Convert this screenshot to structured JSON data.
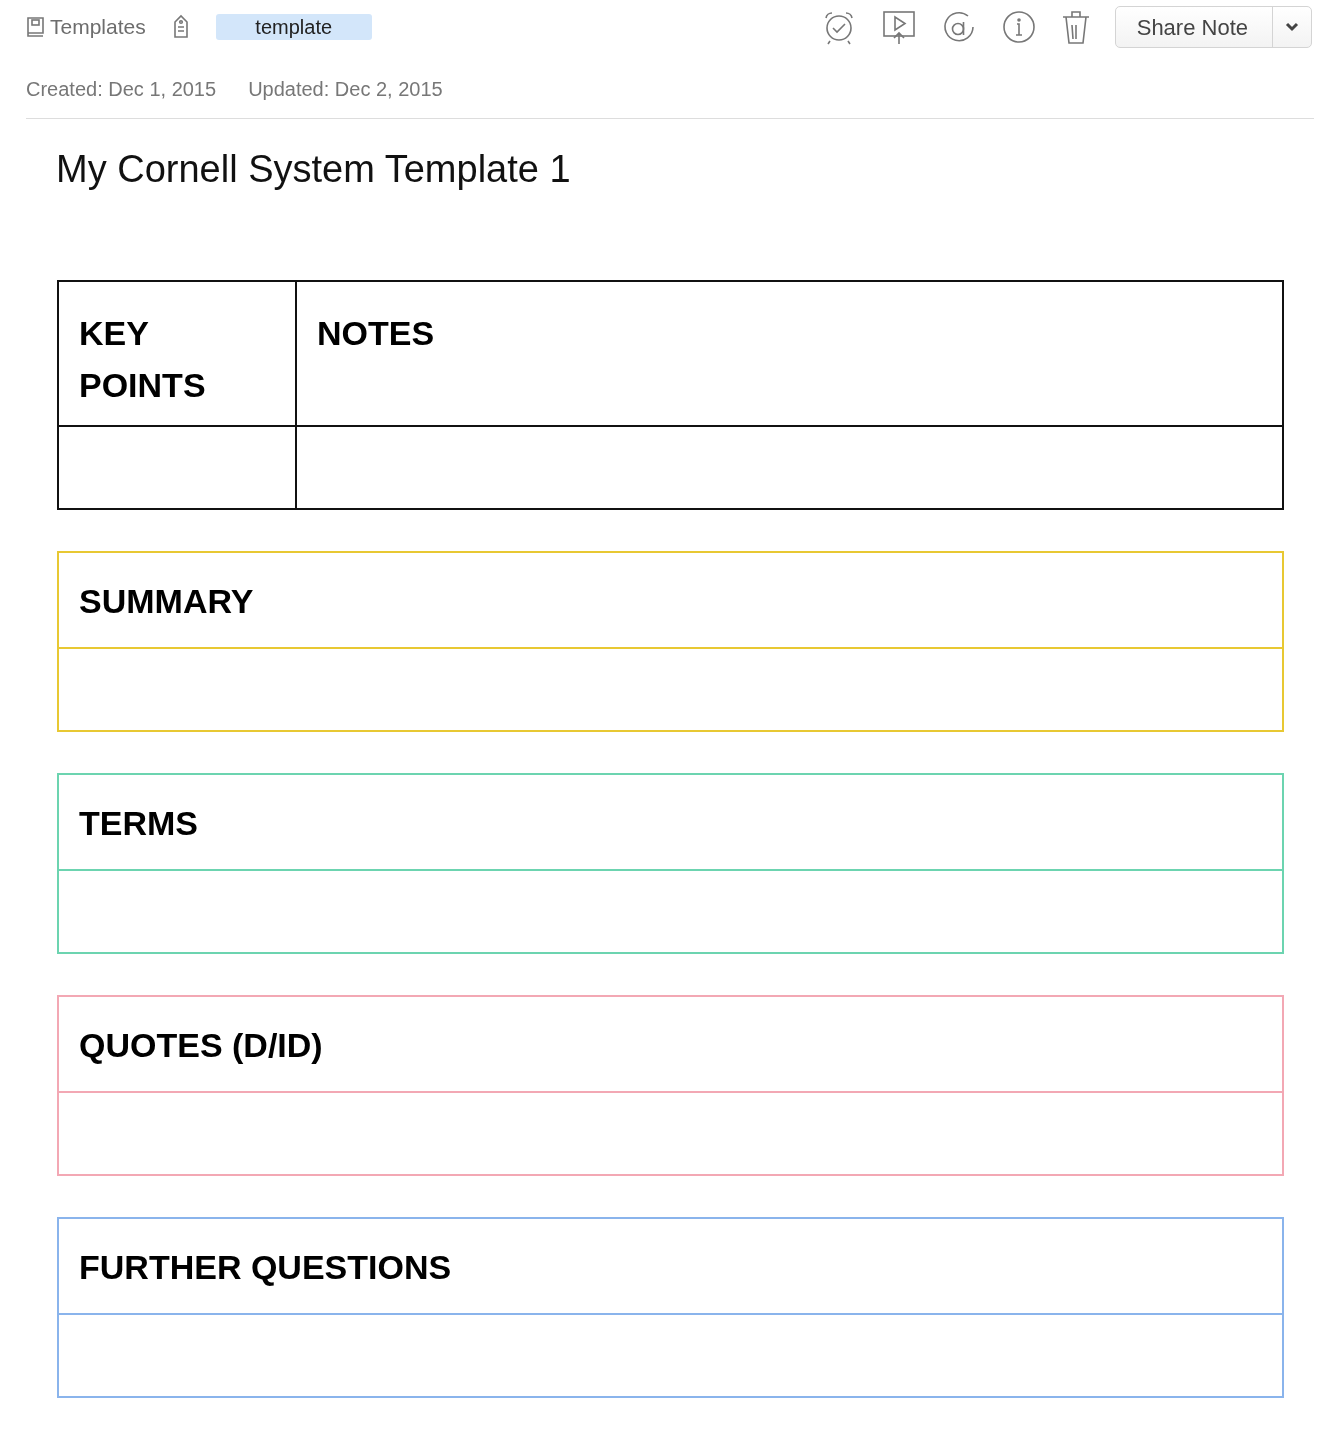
{
  "toolbar": {
    "notebook": "Templates",
    "tags": [
      {
        "label": "template"
      }
    ],
    "share_button": "Share Note"
  },
  "meta": {
    "created": "Created: Dec 1, 2015",
    "updated": "Updated: Dec 2, 2015"
  },
  "note": {
    "title": "My Cornell System Template 1",
    "cornell_table": {
      "columns": [
        "KEY POINTS",
        "NOTES"
      ]
    },
    "sections": [
      {
        "heading": "SUMMARY",
        "color": "#e8c832"
      },
      {
        "heading": "TERMS",
        "color": "#6cd4b0"
      },
      {
        "heading": "QUOTES (D/ID)",
        "color": "#f3a8b4"
      },
      {
        "heading": "FURTHER QUESTIONS",
        "color": "#8ab4ec"
      }
    ]
  }
}
